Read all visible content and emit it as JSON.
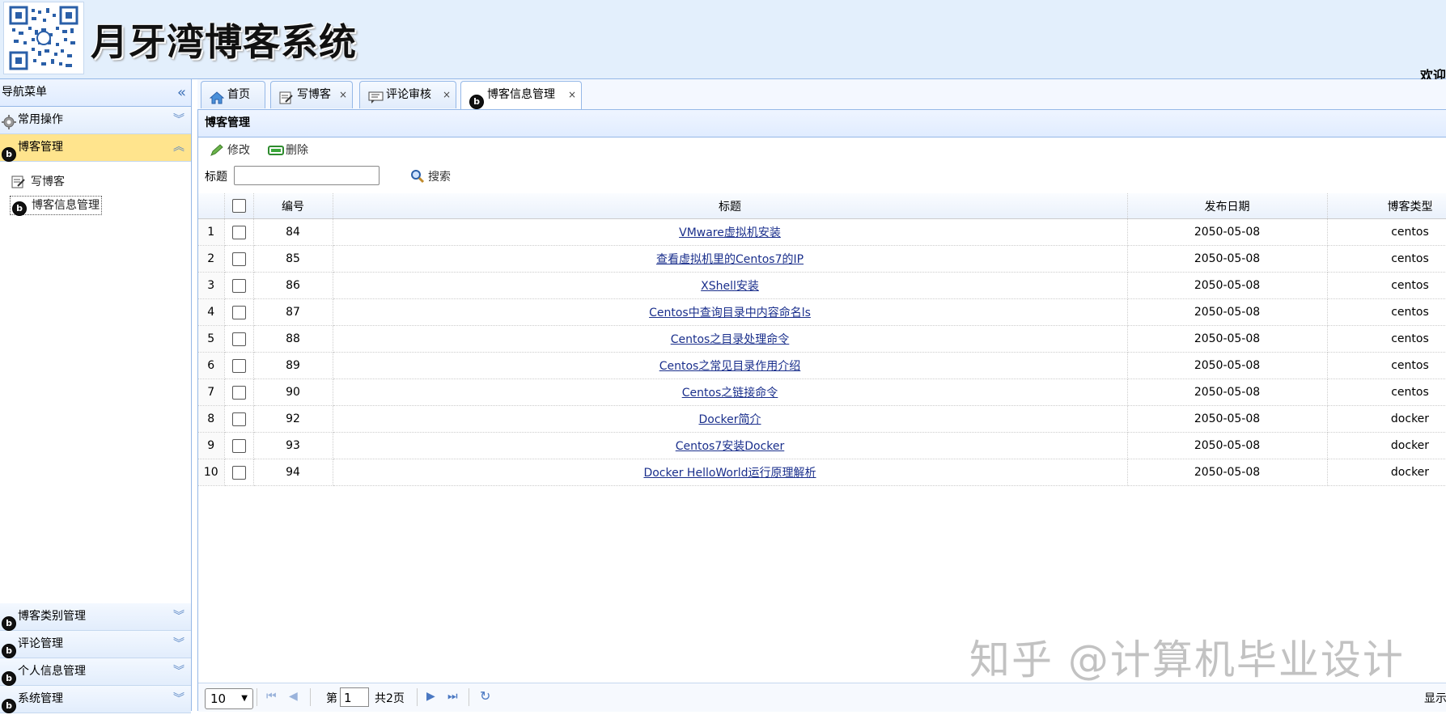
{
  "header": {
    "app_title": "月牙湾博客系统",
    "welcome_text": "欢迎"
  },
  "sidebar": {
    "title": "导航菜单",
    "collapse_icon": "double-chevron-left-icon",
    "sections": [
      {
        "label": "常用操作",
        "icon": "gear-icon",
        "expanded": false
      },
      {
        "label": "博客管理",
        "icon": "blog-icon",
        "expanded": true,
        "items": [
          {
            "label": "写博客",
            "icon": "edit-icon"
          },
          {
            "label": "博客信息管理",
            "icon": "blog-icon",
            "selected": true
          }
        ]
      },
      {
        "label": "博客类别管理",
        "icon": "blog-icon",
        "expanded": false
      },
      {
        "label": "评论管理",
        "icon": "blog-icon",
        "expanded": false
      },
      {
        "label": "个人信息管理",
        "icon": "blog-icon",
        "expanded": false
      },
      {
        "label": "系统管理",
        "icon": "blog-icon",
        "expanded": false
      }
    ]
  },
  "tabs": [
    {
      "label": "首页",
      "icon": "home-icon",
      "closable": false
    },
    {
      "label": "写博客",
      "icon": "edit-icon",
      "closable": true
    },
    {
      "label": "评论审核",
      "icon": "review-icon",
      "closable": true
    },
    {
      "label": "博客信息管理",
      "icon": "blog-icon",
      "closable": true,
      "active": true
    }
  ],
  "tab_close": "×",
  "panel": {
    "title": "博客管理",
    "toolbar": {
      "edit_label": "修改",
      "delete_label": "删除"
    },
    "search": {
      "label": "标题",
      "value": "",
      "button_label": "搜索"
    }
  },
  "grid": {
    "columns": [
      "编号",
      "标题",
      "发布日期",
      "博客类型"
    ],
    "rows": [
      {
        "n": "1",
        "id": "84",
        "title": "VMware虚拟机安装",
        "date": "2050-05-08",
        "type": "centos"
      },
      {
        "n": "2",
        "id": "85",
        "title": "查看虚拟机里的Centos7的IP",
        "date": "2050-05-08",
        "type": "centos"
      },
      {
        "n": "3",
        "id": "86",
        "title": "XShell安装",
        "date": "2050-05-08",
        "type": "centos"
      },
      {
        "n": "4",
        "id": "87",
        "title": "Centos中查询目录中内容命名ls",
        "date": "2050-05-08",
        "type": "centos"
      },
      {
        "n": "5",
        "id": "88",
        "title": "Centos之目录处理命令",
        "date": "2050-05-08",
        "type": "centos"
      },
      {
        "n": "6",
        "id": "89",
        "title": "Centos之常见目录作用介绍",
        "date": "2050-05-08",
        "type": "centos"
      },
      {
        "n": "7",
        "id": "90",
        "title": "Centos之链接命令",
        "date": "2050-05-08",
        "type": "centos"
      },
      {
        "n": "8",
        "id": "92",
        "title": "Docker简介",
        "date": "2050-05-08",
        "type": "docker"
      },
      {
        "n": "9",
        "id": "93",
        "title": "Centos7安装Docker",
        "date": "2050-05-08",
        "type": "docker"
      },
      {
        "n": "10",
        "id": "94",
        "title": "Docker HelloWorld运行原理解析",
        "date": "2050-05-08",
        "type": "docker"
      }
    ]
  },
  "pager": {
    "page_size": "10",
    "page_prefix": "第",
    "current_page": "1",
    "page_suffix": "共2页",
    "display_text": "显示"
  },
  "watermark": "知乎 @计算机毕业设计",
  "colors": {
    "header_bg": "#e3effc",
    "border_blue": "#95b8e7",
    "active_accordion": "#ffe48d",
    "link": "#1a2f8c"
  }
}
